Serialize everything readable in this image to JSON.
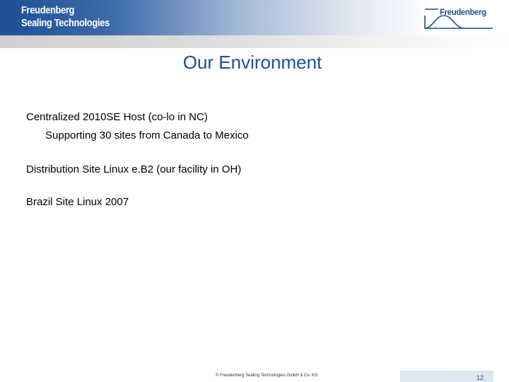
{
  "header": {
    "company_line1": "Freudenberg",
    "company_line2": "Sealing Technologies",
    "logo_text": "Freudenberg"
  },
  "slide": {
    "title": "Our Environment",
    "bullets": [
      "Centralized 2010SE Host (co-lo in NC)",
      "Supporting 30 sites from Canada to Mexico",
      "Distribution Site Linux e.B2 (our facility in OH)",
      "Brazil Site Linux 2007"
    ]
  },
  "footer": {
    "copyright": "© Freudenberg Sealing Technologies GmbH & Co. KG",
    "page_number": "12"
  },
  "colors": {
    "brand_blue": "#1d4f96",
    "header_strip_gray": "#d0d0d0",
    "page_box_bg": "#dde6f1"
  }
}
